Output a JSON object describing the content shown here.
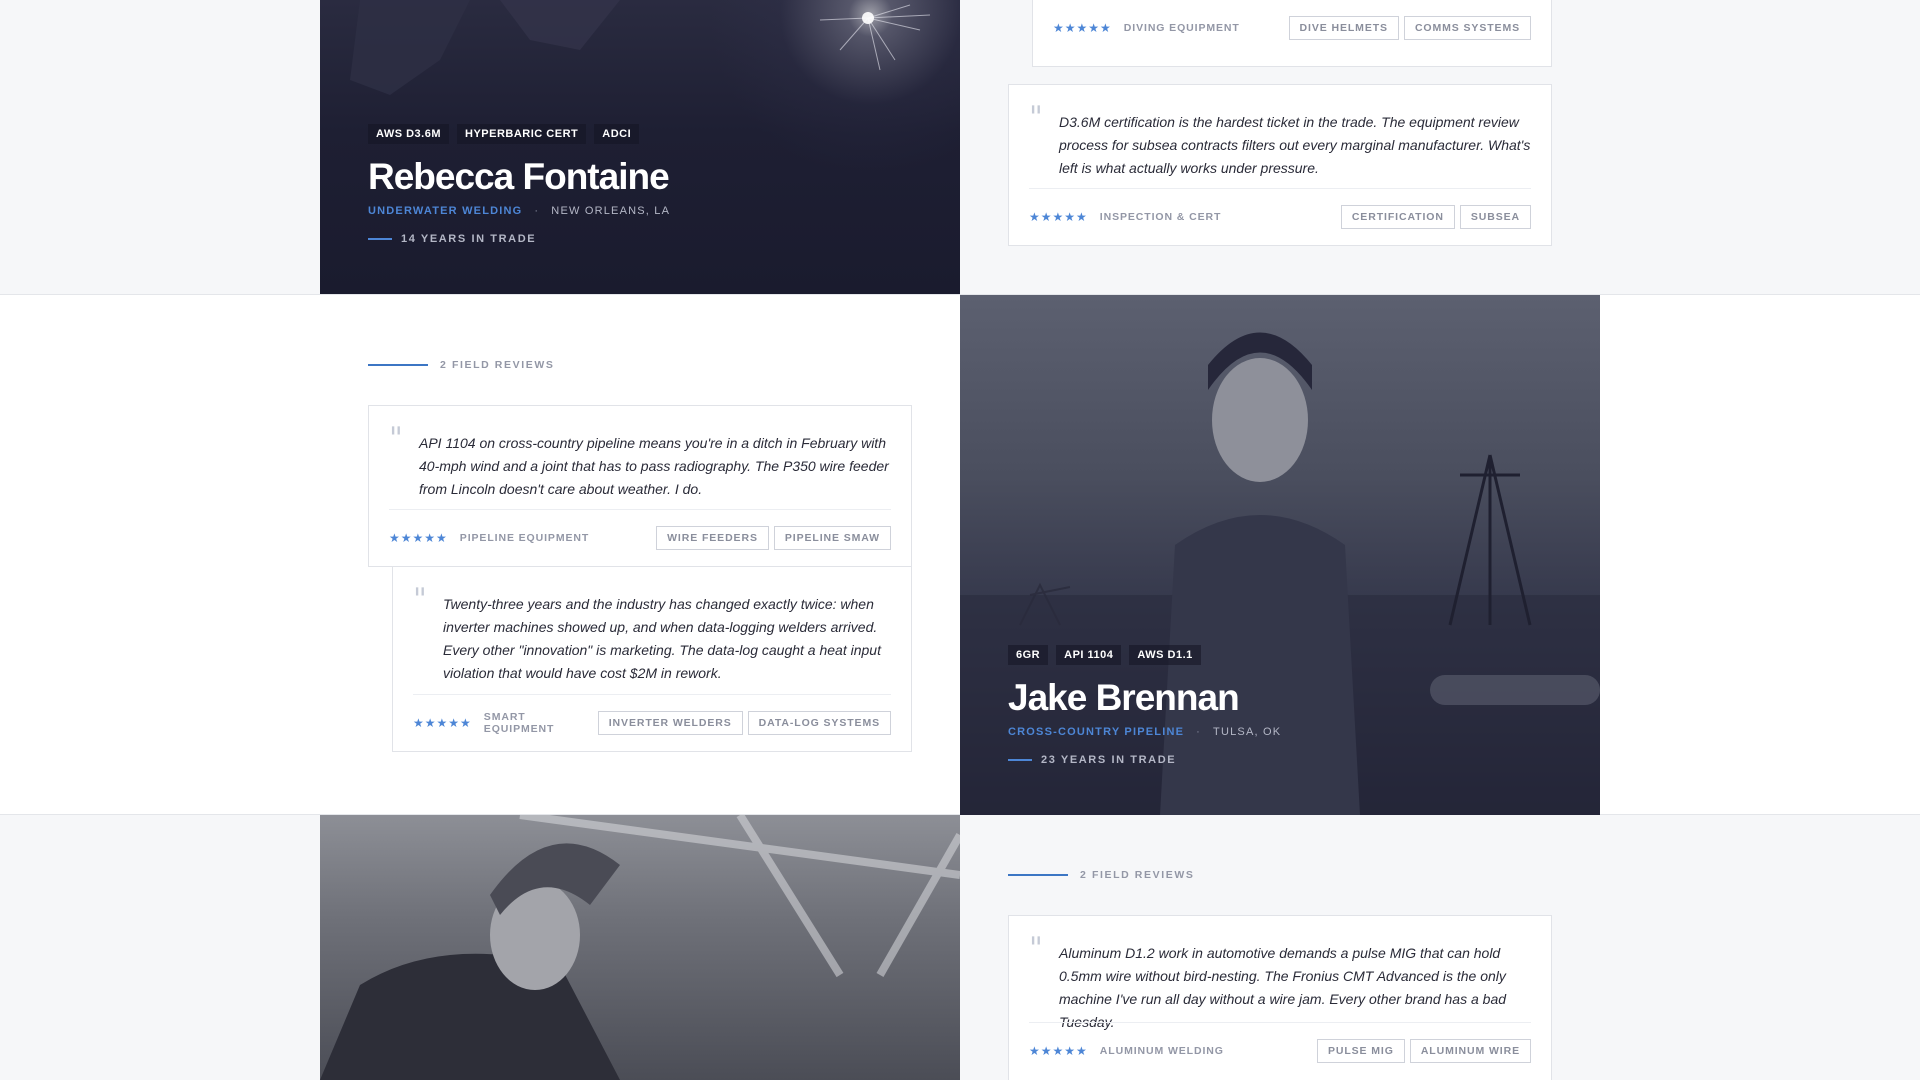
{
  "colors": {
    "accent": "#4d86d6",
    "dark_panel": "#1b1c30",
    "page_bg": "#f6f7f9"
  },
  "profiles": {
    "rebecca": {
      "certs": [
        "AWS D3.6M",
        "HYPERBARIC CERT",
        "ADCI"
      ],
      "name": "Rebecca Fontaine",
      "specialty": "UNDERWATER WELDING",
      "separator": "·",
      "location": "NEW ORLEANS, LA",
      "years": "14 YEARS IN TRADE"
    },
    "jake": {
      "certs": [
        "6GR",
        "API 1104",
        "AWS D1.1"
      ],
      "name": "Jake Brennan",
      "specialty": "CROSS-COUNTRY PIPELINE",
      "separator": "·",
      "location": "TULSA, OK",
      "years": "23 YEARS IN TRADE"
    }
  },
  "rebecca_reviews": [
    {
      "stars": "★★★★★",
      "category": "DIVING EQUIPMENT",
      "tags": [
        "DIVE HELMETS",
        "COMMS SYSTEMS"
      ]
    },
    {
      "quote_mark": "\"",
      "quote": "D3.6M certification is the hardest ticket in the trade. The equipment review process for subsea contracts filters out every marginal manufacturer. What's left is what actually works under pressure.",
      "stars": "★★★★★",
      "category": "INSPECTION & CERT",
      "tags": [
        "CERTIFICATION",
        "SUBSEA"
      ]
    }
  ],
  "jake_reviews": {
    "header": "2 FIELD REVIEWS",
    "items": [
      {
        "quote_mark": "\"",
        "quote": "API 1104 on cross-country pipeline means you're in a ditch in February with 40-mph wind and a joint that has to pass radiography. The P350 wire feeder from Lincoln doesn't care about weather. I do.",
        "stars": "★★★★★",
        "category": "PIPELINE EQUIPMENT",
        "tags": [
          "WIRE FEEDERS",
          "PIPELINE SMAW"
        ]
      },
      {
        "quote_mark": "\"",
        "quote": "Twenty-three years and the industry has changed exactly twice: when inverter machines showed up, and when data-logging welders arrived. Every other \"innovation\" is marketing. The data-log caught a heat input violation that would have cost $2M in rework.",
        "stars": "★★★★★",
        "category": "SMART EQUIPMENT",
        "tags": [
          "INVERTER WELDERS",
          "DATA-LOG SYSTEMS"
        ]
      }
    ]
  },
  "third_reviews": {
    "header": "2 FIELD REVIEWS",
    "items": [
      {
        "quote_mark": "\"",
        "quote": "Aluminum D1.2 work in automotive demands a pulse MIG that can hold 0.5mm wire without bird-nesting. The Fronius CMT Advanced is the only machine I've run all day without a wire jam. Every other brand has a bad Tuesday.",
        "stars": "★★★★★",
        "category": "ALUMINUM WELDING",
        "tags": [
          "PULSE MIG",
          "ALUMINUM WIRE"
        ]
      }
    ]
  }
}
